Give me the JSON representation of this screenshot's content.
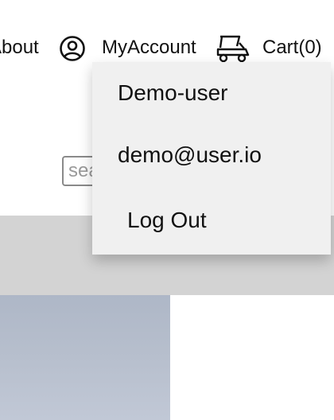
{
  "nav": {
    "about_label": "About",
    "account_label": "MyAccount",
    "account_icon": "user-circle-icon",
    "cart_label": "Cart(0)",
    "cart_icon": "golf-cart-icon"
  },
  "search": {
    "placeholder": "search",
    "value": ""
  },
  "account_menu": {
    "username": "Demo-user",
    "email": "demo@user.io",
    "logout_label": "Log Out"
  },
  "colors": {
    "banner": "#d3d3d3",
    "dropdown_bg": "#f0f0f0",
    "image_tint": "#b7bfcd"
  }
}
